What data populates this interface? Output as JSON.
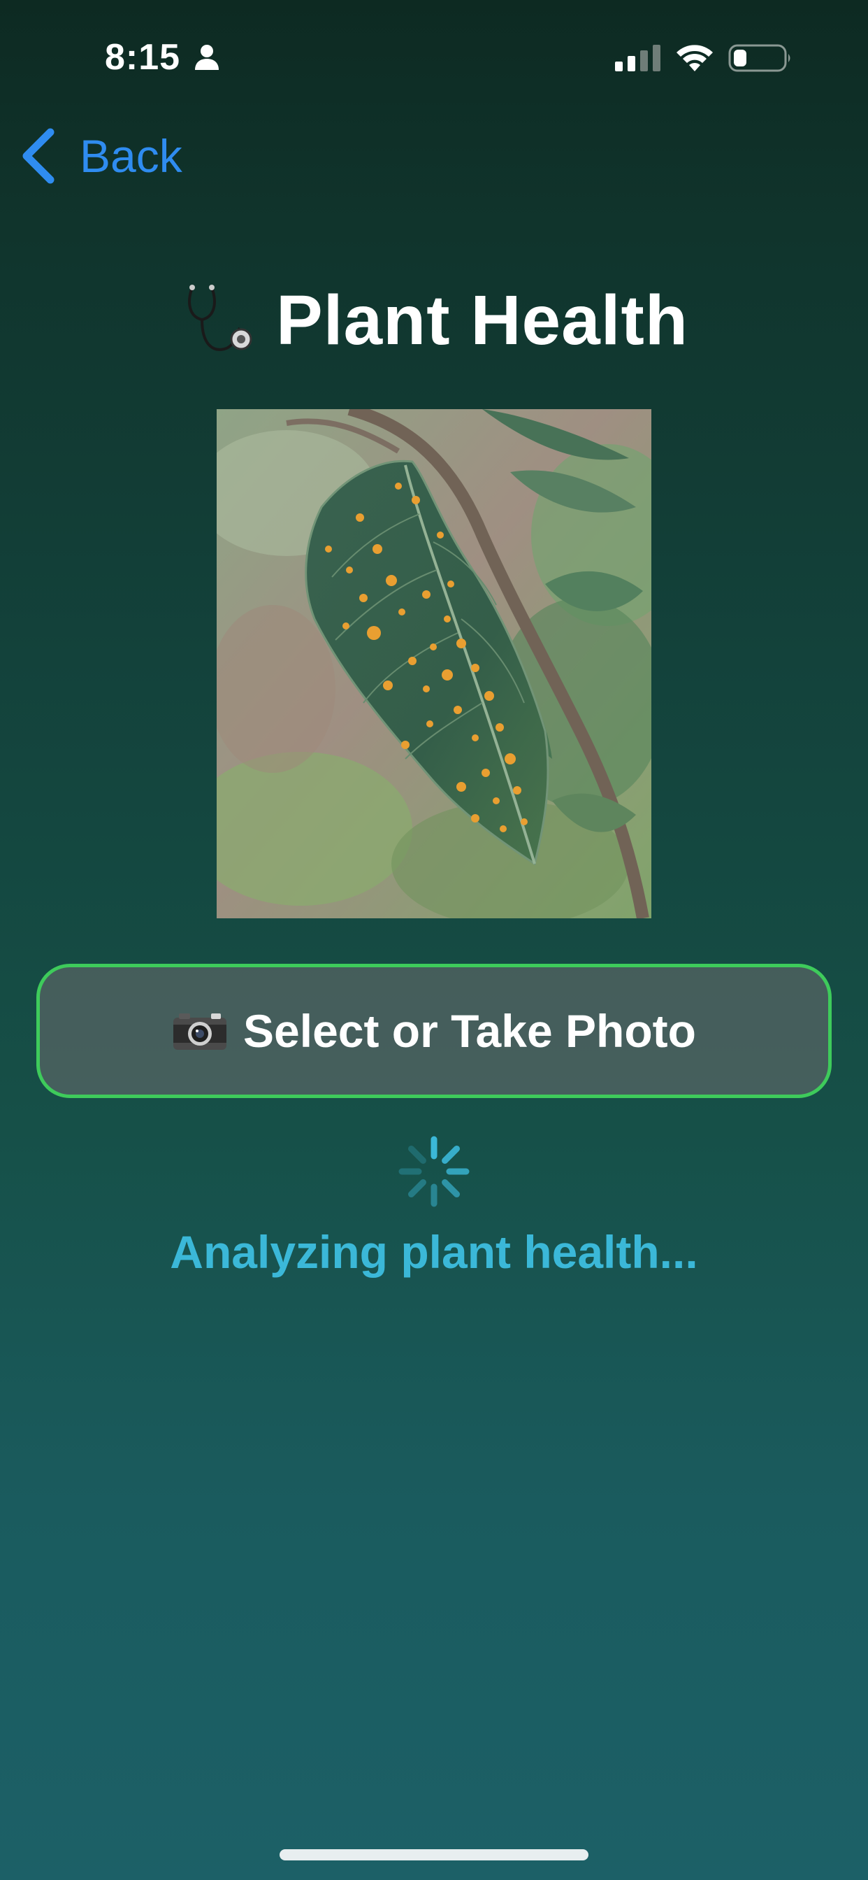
{
  "status_bar": {
    "time": "8:15",
    "icons": [
      "person-icon",
      "cellular-signal-icon",
      "wifi-icon",
      "battery-icon"
    ]
  },
  "nav": {
    "back_label": "Back",
    "back_icon": "chevron-left-icon"
  },
  "header": {
    "title": "Plant Health",
    "icon": "stethoscope-icon"
  },
  "photo": {
    "subject": "leaf-photo"
  },
  "select_button": {
    "label": "Select or Take Photo",
    "icon": "camera-icon"
  },
  "status": {
    "text": "Analyzing plant health...",
    "icon": "spinner-icon"
  },
  "colors": {
    "accent_blue": "#2f8cf0",
    "button_border": "#3ecb5b",
    "status_text": "#3bb8d8",
    "background_top": "#0d2a22",
    "background_bottom": "#1c6067"
  }
}
